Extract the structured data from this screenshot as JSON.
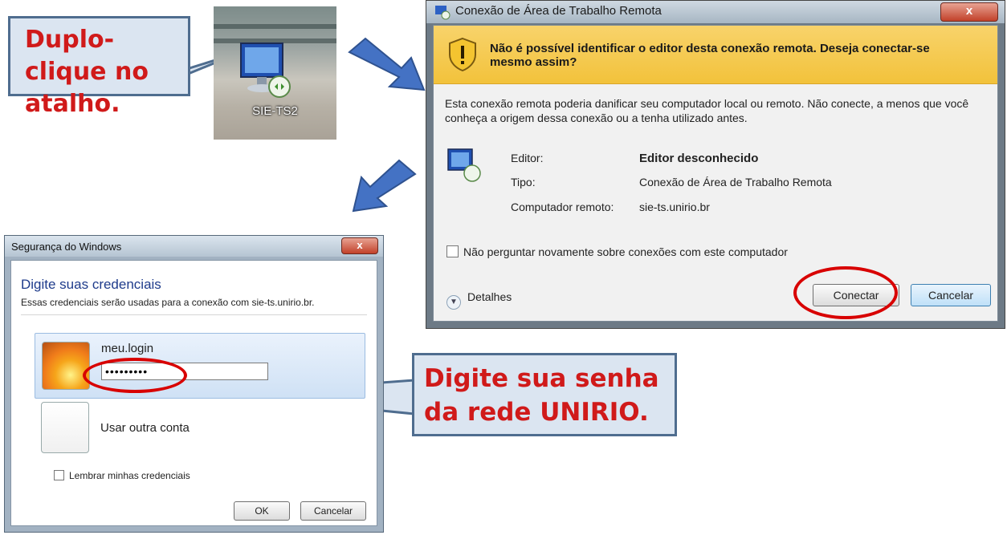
{
  "callouts": {
    "double_click": "Duplo-clique no atalho.",
    "enter_password": "Digite sua senha da rede UNIRIO."
  },
  "shortcut": {
    "label": "SIE-TS2",
    "icon": "remote-desktop-icon"
  },
  "remote_dialog": {
    "title": "Conexão de Área de Trabalho Remota",
    "close_label": "x",
    "warning": "Não é possível identificar o editor desta conexão remota. Deseja conectar-se mesmo assim?",
    "description": "Esta conexão remota poderia danificar seu computador local ou remoto. Não conecte, a menos que você conheça a origem dessa conexão ou a tenha utilizado antes.",
    "fields": [
      {
        "label": "Editor:",
        "value": "Editor desconhecido"
      },
      {
        "label": "Tipo:",
        "value": "Conexão de Área de Trabalho Remota"
      },
      {
        "label": "Computador remoto:",
        "value": "sie-ts.unirio.br"
      }
    ],
    "checkbox_label": "Não perguntar novamente sobre conexões com este computador",
    "details_label": "Detalhes",
    "connect_label": "Conectar",
    "cancel_label": "Cancelar"
  },
  "security_dialog": {
    "title": "Segurança do Windows",
    "close_label": "x",
    "heading": "Digite suas credenciais",
    "subtitle": "Essas credenciais serão usadas para a conexão com sie-ts.unirio.br.",
    "username": "meu.login",
    "password_mask": "•••••••••",
    "other_account": "Usar outra conta",
    "remember_label": "Lembrar minhas credenciais",
    "ok_label": "OK",
    "cancel_label": "Cancelar"
  },
  "colors": {
    "callout_text": "#d01a1a",
    "callout_bg": "#dbe5f1",
    "highlight": "#d80000",
    "arrow": "#4472c4"
  }
}
